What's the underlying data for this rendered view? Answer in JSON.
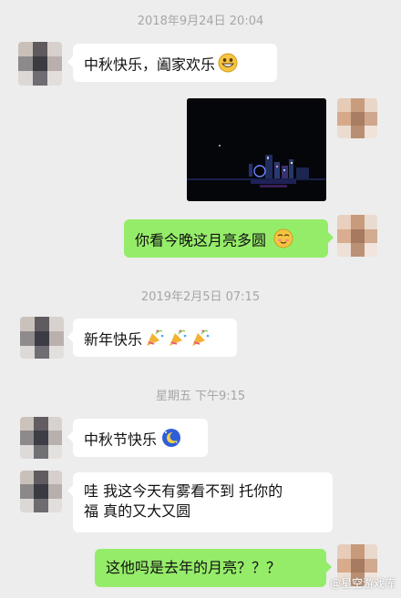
{
  "chat": {
    "ts1": "2018年9月24日 20:04",
    "msg1": "中秋快乐，阖家欢乐",
    "msg3": "你看今晚这月亮多圆",
    "ts2": "2019年2月5日 07:15",
    "msg4": "新年快乐",
    "ts3": "星期五 下午9:15",
    "msg5": "中秋节快乐",
    "msg6_line1": "哇 我这今天有雾看不到 托你的",
    "msg6_line2": "福 真的又大又圆",
    "msg7": "这他吗是去年的月亮？？？"
  },
  "icons": {
    "grin": "grin-emoji-icon",
    "smirk": "smirk-emoji-icon",
    "party": "party-popper-icon",
    "moon": "moon-emoji-icon"
  },
  "colors": {
    "background": "#ededed",
    "incoming_bubble": "#ffffff",
    "outgoing_bubble": "#95ec69",
    "timestamp": "#a6a6a6"
  },
  "watermark": "@星空游戏库"
}
